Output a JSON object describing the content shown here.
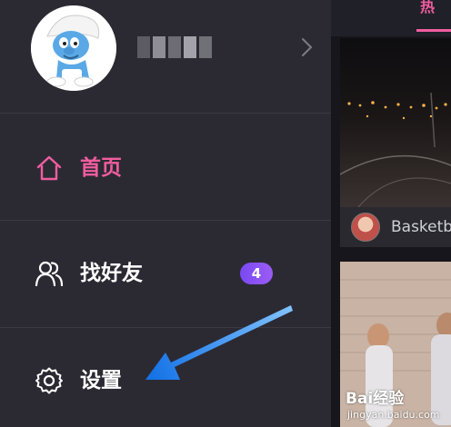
{
  "profile": {
    "username_pixelated": true,
    "avatar_icon": "smurf-avatar"
  },
  "menu": {
    "items": [
      {
        "label": "首页",
        "icon": "home-icon",
        "color": "#f15d9f",
        "active": true
      },
      {
        "label": "找好友",
        "icon": "friends-icon",
        "color": "#ffffff",
        "badge": "4"
      },
      {
        "label": "设置",
        "icon": "gear-icon",
        "color": "#ffffff"
      }
    ]
  },
  "content": {
    "active_tab_label": "热",
    "card1": {
      "title": "Basketb"
    }
  },
  "colors": {
    "drawer_bg": "#2b2a33",
    "accent": "#f15d9f",
    "badge": "#8552f5",
    "annotation_arrow": "#1e90ff"
  },
  "watermark": {
    "logo": "Bai经验",
    "url": "jingyan.baidu.com"
  }
}
